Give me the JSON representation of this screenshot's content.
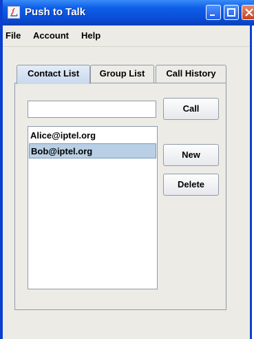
{
  "window": {
    "title": "Push to Talk"
  },
  "menu": {
    "items": [
      "File",
      "Account",
      "Help"
    ]
  },
  "tabs": [
    {
      "label": "Contact List",
      "active": true
    },
    {
      "label": "Group List",
      "active": false
    },
    {
      "label": "Call History",
      "active": false
    }
  ],
  "contact_list": {
    "input_value": "",
    "call_label": "Call",
    "new_label": "New",
    "delete_label": "Delete",
    "contacts": [
      "Alice@iptel.org",
      "Bob@iptel.org"
    ],
    "selected": "Bob@iptel.org"
  },
  "colors": {
    "titlebar": "#0a4fd8",
    "selection": "#b8cfe5",
    "close_button": "#c8401f"
  },
  "icons": [
    "java-app-icon",
    "minimize-icon",
    "maximize-icon",
    "close-icon"
  ]
}
